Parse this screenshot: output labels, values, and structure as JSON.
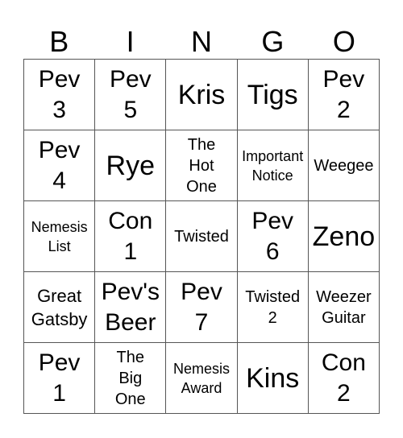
{
  "header": [
    "B",
    "I",
    "N",
    "G",
    "O"
  ],
  "cells": [
    {
      "text": "Pev\n3",
      "size": "l"
    },
    {
      "text": "Pev\n5",
      "size": "l"
    },
    {
      "text": "Kris",
      "size": "xl"
    },
    {
      "text": "Tigs",
      "size": "xl"
    },
    {
      "text": "Pev\n2",
      "size": "l"
    },
    {
      "text": "Pev\n4",
      "size": "l"
    },
    {
      "text": "Rye",
      "size": "xl"
    },
    {
      "text": "The\nHot\nOne",
      "size": "ms"
    },
    {
      "text": "Important\nNotice",
      "size": "s"
    },
    {
      "text": "Weegee",
      "size": "ms"
    },
    {
      "text": "Nemesis\nList",
      "size": "s"
    },
    {
      "text": "Con\n1",
      "size": "l"
    },
    {
      "text": "Twisted",
      "size": "ms"
    },
    {
      "text": "Pev\n6",
      "size": "l"
    },
    {
      "text": "Zeno",
      "size": "xl"
    },
    {
      "text": "Great\nGatsby",
      "size": "m"
    },
    {
      "text": "Pev's\nBeer",
      "size": "l"
    },
    {
      "text": "Pev\n7",
      "size": "l"
    },
    {
      "text": "Twisted\n2",
      "size": "ms"
    },
    {
      "text": "Weezer\nGuitar",
      "size": "ms"
    },
    {
      "text": "Pev\n1",
      "size": "l"
    },
    {
      "text": "The\nBig\nOne",
      "size": "ms"
    },
    {
      "text": "Nemesis\nAward",
      "size": "s"
    },
    {
      "text": "Kins",
      "size": "xl"
    },
    {
      "text": "Con\n2",
      "size": "l"
    }
  ]
}
